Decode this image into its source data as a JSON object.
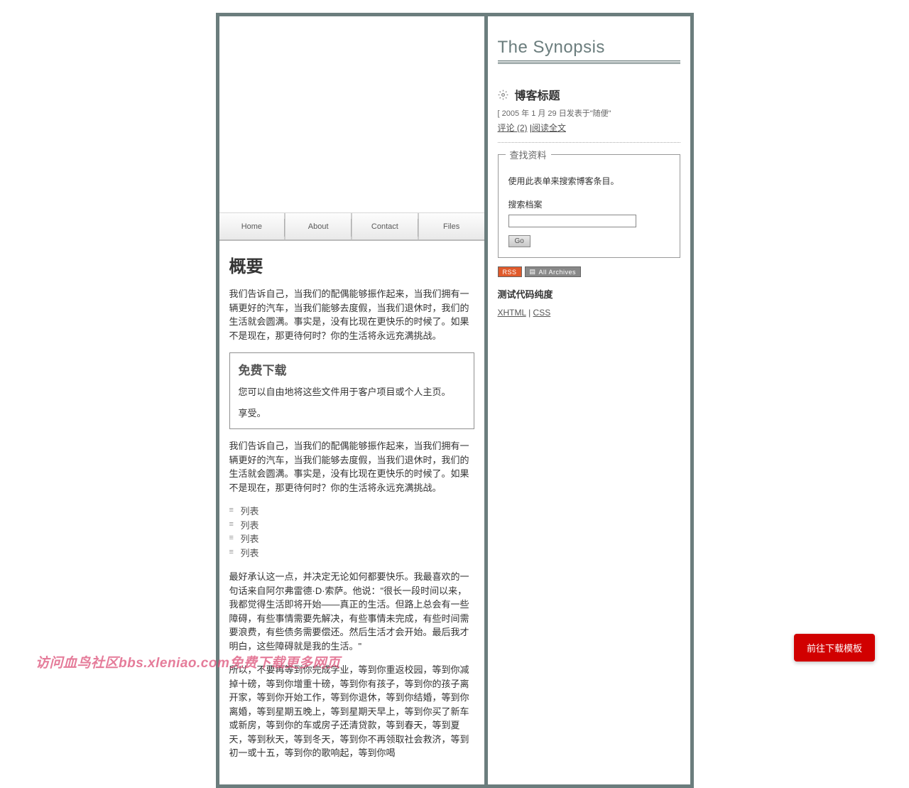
{
  "nav": {
    "items": [
      "Home",
      "About",
      "Contact",
      "Files"
    ]
  },
  "main": {
    "title": "概要",
    "para1": "我们告诉自己，当我们的配偶能够振作起来，当我们拥有一辆更好的汽车，当我们能够去度假，当我们退休时，我们的生活就会圆满。事实是，没有比现在更快乐的时候了。如果不是现在，那更待何时？你的生活将永远充满挑战。",
    "download": {
      "title": "免费下载",
      "line1": "您可以自由地将这些文件用于客户项目或个人主页。",
      "line2": "享受。"
    },
    "para2": "我们告诉自己，当我们的配偶能够振作起来，当我们拥有一辆更好的汽车，当我们能够去度假，当我们退休时，我们的生活就会圆满。事实是，没有比现在更快乐的时候了。如果不是现在，那更待何时？你的生活将永远充满挑战。",
    "list": [
      "列表",
      "列表",
      "列表",
      "列表"
    ],
    "para3": "最好承认这一点，并决定无论如何都要快乐。我最喜欢的一句话来自阿尔弗雷德·D·索萨。他说：\"很长一段时间以来，我都觉得生活即将开始——真正的生活。但路上总会有一些障碍，有些事情需要先解决，有些事情未完成，有些时间需要浪费，有些债务需要偿还。然后生活才会开始。最后我才明白，这些障碍就是我的生活。\"",
    "para4": "所以，不要再等到你完成学业，等到你重返校园，等到你减掉十磅，等到你增重十磅，等到你有孩子，等到你的孩子离开家，等到你开始工作，等到你退休，等到你结婚，等到你离婚，等到星期五晚上，等到星期天早上，等到你买了新车或新房，等到你的车或房子还清贷款，等到春天，等到夏天，等到秋天，等到冬天，等到你不再领取社会救济，等到初一或十五，等到你的歌响起，等到你喝"
  },
  "sidebar": {
    "site_title": "The Synopsis",
    "blog_title": "博客标题",
    "post_meta": "[ 2005 年 1 月 29 日发表于\"随便\"",
    "comments_link": "评论 (2)",
    "readmore_link": "阅读全文",
    "search": {
      "legend": "查找资料",
      "desc": "使用此表单来搜索博客条目。",
      "label": "搜索档案",
      "button": "Go"
    },
    "badges": {
      "rss": "RSS",
      "archives": "All Archives"
    },
    "purity_heading": "测试代码纯度",
    "xhtml": "XHTML",
    "separator": " | ",
    "css": "CSS"
  },
  "floating_button": "前往下载模板",
  "watermark": "访问血鸟社区bbs.xleniao.com免费下载更多网页"
}
